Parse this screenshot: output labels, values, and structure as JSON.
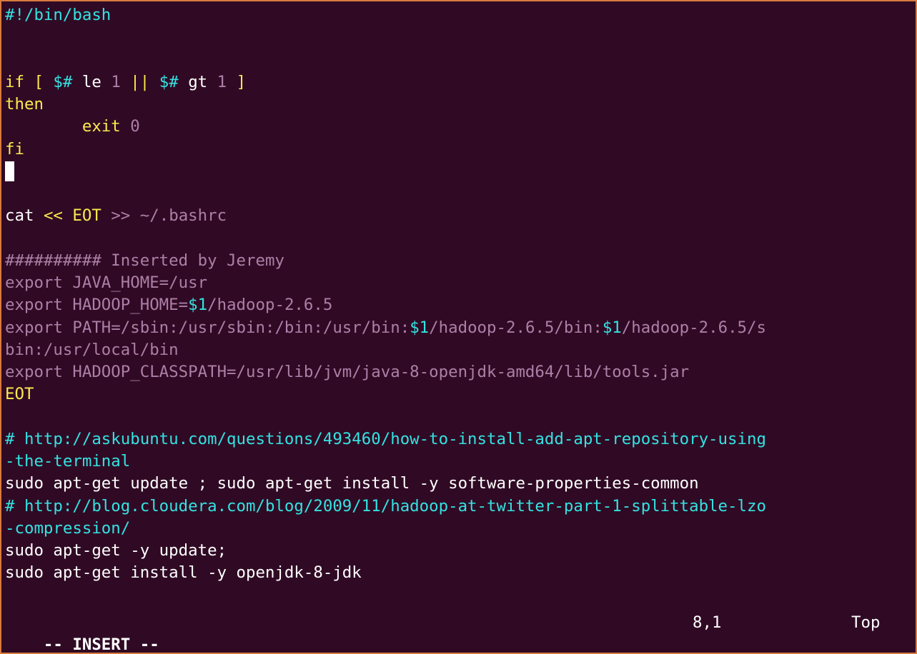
{
  "editor": {
    "mode_label": "-- INSERT --",
    "cursor_position": "8,1",
    "scroll_position": "Top"
  },
  "code": {
    "shebang": "#!/bin/bash",
    "if_kw": "if",
    "lbracket": "[",
    "argc1": "$#",
    "le_op": "le",
    "one_a": "1",
    "or_op": "||",
    "argc2": "$#",
    "gt_op": "gt",
    "one_b": "1",
    "rbracket": "]",
    "then_kw": "then",
    "exit_indent": "        ",
    "exit_kw": "exit",
    "zero": "0",
    "fi_kw": "fi",
    "cat_cmd": "cat",
    "heredoc_op": "<<",
    "eot_start": "EOT",
    "redirect_target": ">> ~/.bashrc",
    "heredoc_comment": "########## Inserted by Jeremy",
    "java_home": "export JAVA_HOME=/usr",
    "hadoop_home_pre": "export HADOOP_HOME=",
    "var1_a": "$1",
    "hadoop_home_post": "/hadoop-2.6.5",
    "path_pre": "export PATH=/sbin:/usr/sbin:/bin:/usr/bin:",
    "var1_b": "$1",
    "path_mid": "/hadoop-2.6.5/bin:",
    "var1_c": "$1",
    "path_post": "/hadoop-2.6.5/s",
    "path_wrap": "bin:/usr/local/bin",
    "classpath": "export HADOOP_CLASSPATH=/usr/lib/jvm/java-8-openjdk-amd64/lib/tools.jar",
    "eot_end": "EOT",
    "comment_url1": "# http://askubuntu.com/questions/493460/how-to-install-add-apt-repository-using",
    "comment_url1_wrap": "-the-terminal",
    "apt_update_install": "sudo apt-get update ; sudo apt-get install -y software-properties-common",
    "comment_url2": "# http://blog.cloudera.com/blog/2009/11/hadoop-at-twitter-part-1-splittable-lzo",
    "comment_url2_wrap": "-compression/",
    "apt_update": "sudo apt-get -y update;",
    "apt_install_jdk": "sudo apt-get install -y openjdk-8-jdk"
  }
}
